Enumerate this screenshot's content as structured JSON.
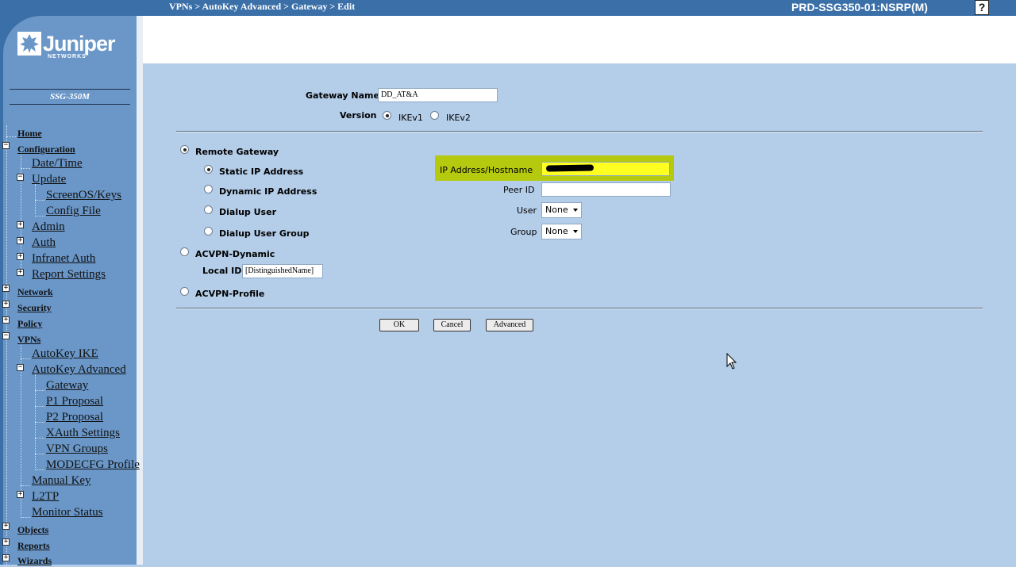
{
  "header": {
    "breadcrumb": "VPNs > AutoKey Advanced > Gateway > Edit",
    "device": "PRD-SSG350-01:NSRP(M)",
    "help": "?"
  },
  "brand": {
    "logo_text": "Juniper",
    "logo_sub": "NETWORKS",
    "model": "SSG-350M",
    "colors": {
      "sidebar": "#6a97c8",
      "topbar": "#3a6fa8",
      "content": "#b4cde8",
      "highlight": "#b5c90e"
    }
  },
  "nav": {
    "home": "Home",
    "configuration": "Configuration",
    "datetime": "Date/Time",
    "update": "Update",
    "screenos": "ScreenOS/Keys",
    "configfile": "Config File",
    "admin": "Admin",
    "auth": "Auth",
    "infranet": "Infranet Auth",
    "report_settings": "Report Settings",
    "network": "Network",
    "security": "Security",
    "policy": "Policy",
    "vpns": "VPNs",
    "autokey_ike": "AutoKey IKE",
    "autokey_adv": "AutoKey Advanced",
    "gateway": "Gateway",
    "p1": "P1 Proposal",
    "p2": "P2 Proposal",
    "xauth": "XAuth Settings",
    "vpn_groups": "VPN Groups",
    "modecfg": "MODECFG Profile",
    "manual_key": "Manual Key",
    "l2tp": "L2TP",
    "monitor": "Monitor Status",
    "objects": "Objects",
    "reports": "Reports",
    "wizards": "Wizards",
    "expand_icon": "+",
    "collapse_icon": "−"
  },
  "form": {
    "gateway_name_label": "Gateway Name",
    "gateway_name_value": "DD_AT&A",
    "version_label": "Version",
    "ikev1": "IKEv1",
    "ikev2": "IKEv2",
    "remote_gateway": "Remote Gateway",
    "static_ip": "Static IP Address",
    "dynamic_ip": "Dynamic IP Address",
    "dialup_user": "Dialup User",
    "dialup_group": "Dialup User Group",
    "ip_hostname_label": "IP Address/Hostname",
    "peer_id_label": "Peer ID",
    "user_label": "User",
    "user_value": "None",
    "group_label": "Group",
    "group_value": "None",
    "acvpn_dynamic": "ACVPN-Dynamic",
    "local_id_label": "Local ID",
    "local_id_value": "[DistinguishedName]",
    "acvpn_profile": "ACVPN-Profile"
  },
  "buttons": {
    "ok": "OK",
    "cancel": "Cancel",
    "advanced": "Advanced"
  }
}
